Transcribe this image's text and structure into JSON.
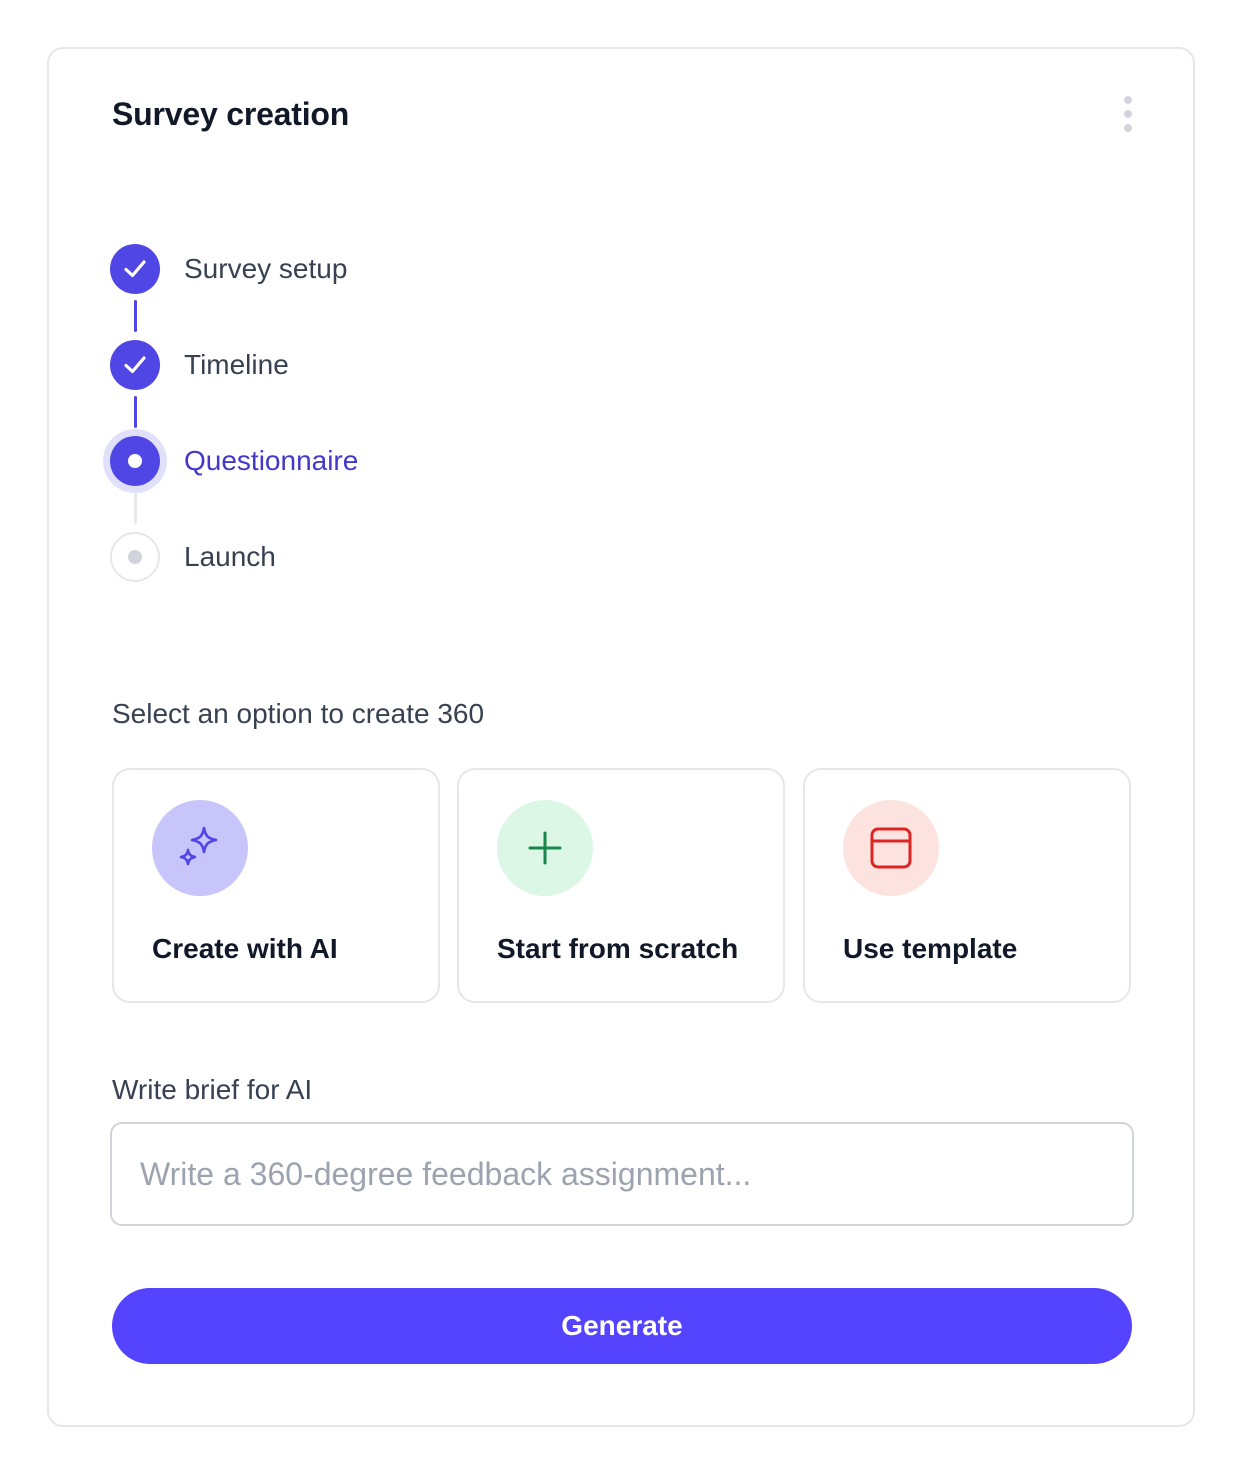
{
  "card": {
    "title": "Survey creation",
    "menu_icon": "more-vertical-icon"
  },
  "stepper": {
    "steps": [
      {
        "label": "Survey setup",
        "status": "completed",
        "icon": "check-icon"
      },
      {
        "label": "Timeline",
        "status": "completed",
        "icon": "check-icon"
      },
      {
        "label": "Questionnaire",
        "status": "current",
        "icon": "current-dot-icon"
      },
      {
        "label": "Launch",
        "status": "pending",
        "icon": "pending-dot-icon"
      }
    ]
  },
  "options_section": {
    "label": "Select an option to create 360",
    "options": [
      {
        "label": "Create with AI",
        "icon": "sparkles-icon",
        "icon_color": "#4f46e5",
        "icon_bg": "#c7c5fa"
      },
      {
        "label": "Start from scratch",
        "icon": "plus-icon",
        "icon_color": "#16894a",
        "icon_bg": "#dcf7e6"
      },
      {
        "label": "Use template",
        "icon": "template-icon",
        "icon_color": "#dc2626",
        "icon_bg": "#fde3df"
      }
    ]
  },
  "brief": {
    "label": "Write brief for AI",
    "value": "",
    "placeholder": "Write a 360-degree feedback assignment..."
  },
  "generate_button": {
    "label": "Generate"
  },
  "colors": {
    "accent": "#4f46e5",
    "button": "#5544ff",
    "active_step_text": "#4338ca",
    "border": "#e5e7eb"
  }
}
